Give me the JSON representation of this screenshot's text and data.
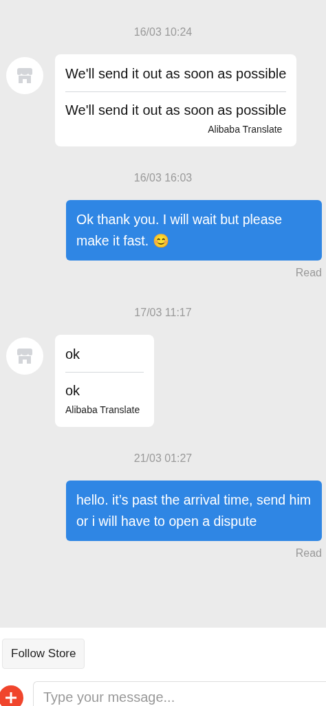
{
  "messages": [
    {
      "kind": "received",
      "time": "16/03 10:24",
      "original": "We'll send it out as soon as possible",
      "translation": "We'll send it out as soon as possible",
      "translator": "Alibaba Translate"
    },
    {
      "kind": "sent",
      "time": "16/03 16:03",
      "text": "Ok thank you. I will wait but please make it fast. 😊",
      "status": "Read"
    },
    {
      "kind": "received",
      "time": "17/03 11:17",
      "original": "ok",
      "translation": "ok",
      "translator": "Alibaba Translate"
    },
    {
      "kind": "sent",
      "time": "21/03 01:27",
      "text": "hello. it’s past the arrival time, send him or i will have to open a dispute",
      "status": "Read"
    }
  ],
  "follow_button": "Follow Store",
  "composer": {
    "placeholder": "Type your message..."
  }
}
